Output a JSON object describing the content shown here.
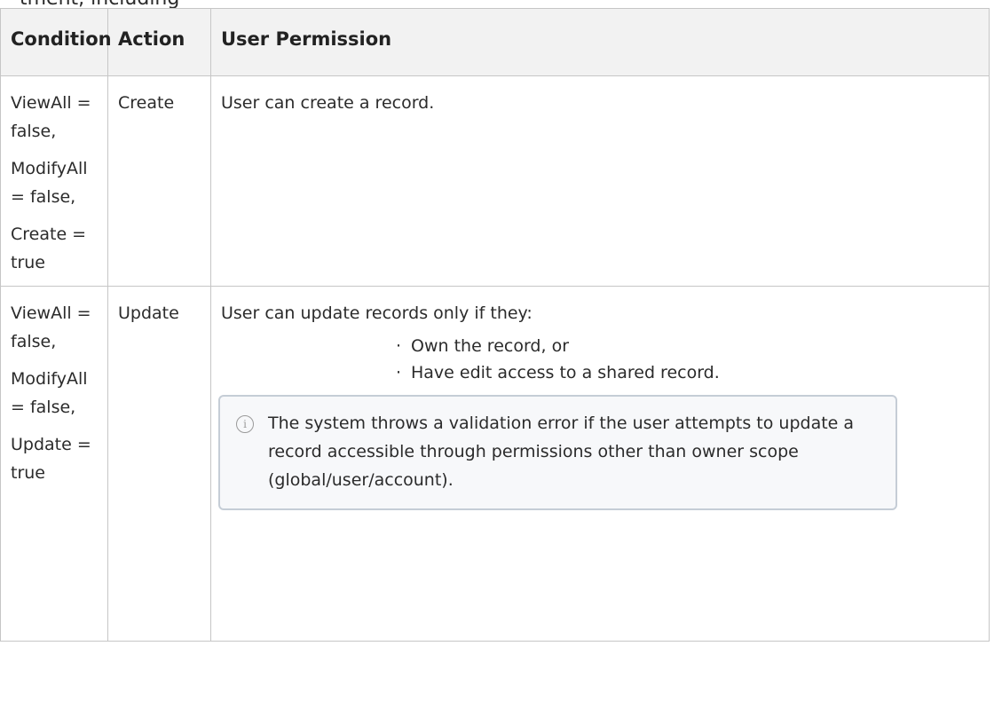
{
  "top_fragment": "tment, including",
  "table": {
    "headers": {
      "condition": "Condition",
      "action": "Action",
      "user_permission": "User Permission"
    },
    "rows": [
      {
        "condition": [
          "ViewAll = false,",
          "ModifyAll = false,",
          "Create = true"
        ],
        "action": "Create",
        "permission_text": "User can create a record."
      },
      {
        "condition": [
          "ViewAll = false,",
          "ModifyAll = false,",
          "Update = true"
        ],
        "action": "Update",
        "permission_text": "User can update records only if they:",
        "bullets": [
          "Own the record, or",
          "Have edit access to a shared record."
        ],
        "note": {
          "icon": "info-icon",
          "text": "The system throws a validation error if the user attempts to update a record accessible through permissions other than owner scope (global/user/account)."
        }
      }
    ]
  }
}
